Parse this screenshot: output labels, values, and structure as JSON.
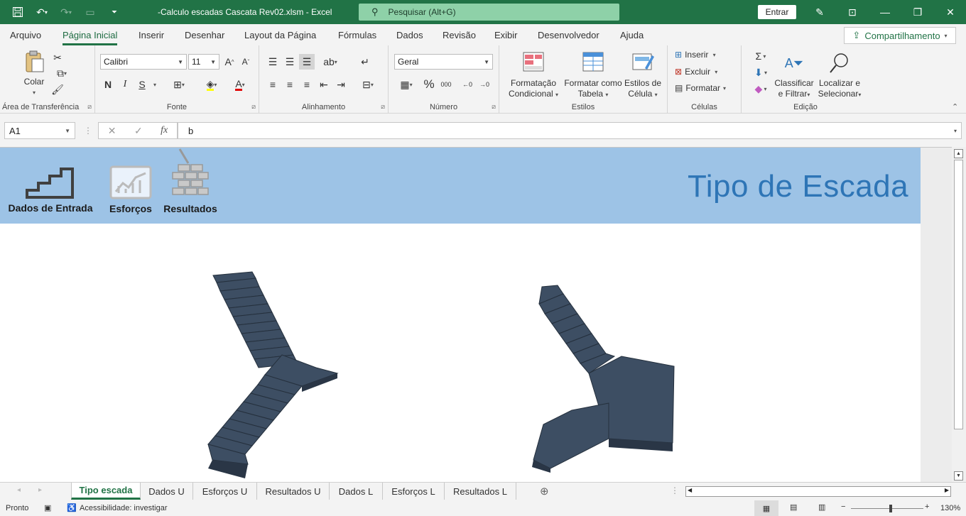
{
  "window": {
    "title": "-Calculo escadas Cascata Rev02.xlsm  -  Excel",
    "search_placeholder": "Pesquisar (Alt+G)",
    "signin_label": "Entrar"
  },
  "menu": {
    "tabs": [
      "Arquivo",
      "Página Inicial",
      "Inserir",
      "Desenhar",
      "Layout da Página",
      "Fórmulas",
      "Dados",
      "Revisão",
      "Exibir",
      "Desenvolvedor",
      "Ajuda"
    ],
    "active_tab": "Página Inicial",
    "share_label": "Compartilhamento"
  },
  "ribbon": {
    "clipboard": {
      "label": "Área de Transferência",
      "paste": "Colar"
    },
    "font": {
      "label": "Fonte",
      "name": "Calibri",
      "size": "11",
      "bold": "N",
      "italic": "I",
      "underline": "S"
    },
    "alignment": {
      "label": "Alinhamento"
    },
    "number": {
      "label": "Número",
      "format": "Geral"
    },
    "styles": {
      "label": "Estilos",
      "conditional_1": "Formatação",
      "conditional_2": "Condicional",
      "table_1": "Formatar como",
      "table_2": "Tabela",
      "cell_1": "Estilos de",
      "cell_2": "Célula"
    },
    "cells": {
      "label": "Células",
      "insert": "Inserir",
      "delete": "Excluir",
      "format": "Formatar"
    },
    "editing": {
      "label": "Edição",
      "sort_1": "Classificar",
      "sort_2": "e Filtrar",
      "find_1": "Localizar e",
      "find_2": "Selecionar"
    }
  },
  "formula_bar": {
    "cell_ref": "A1",
    "content": "b"
  },
  "sheet": {
    "nav": {
      "entrada": "Dados de Entrada",
      "esforcos": "Esforços",
      "resultados": "Resultados"
    },
    "banner_title": "Tipo de Escada",
    "colors": {
      "banner": "#9dc3e6",
      "title": "#2e75b6",
      "stair_top": "#3d4e63",
      "stair_side": "#2a3646"
    }
  },
  "sheet_tabs": [
    "Tipo escada",
    "Dados U",
    "Esforços U",
    "Resultados U",
    "Dados L",
    "Esforços L",
    "Resultados L"
  ],
  "active_sheet": "Tipo escada",
  "status": {
    "ready": "Pronto",
    "accessibility": "Acessibilidade: investigar",
    "zoom": "130%"
  }
}
